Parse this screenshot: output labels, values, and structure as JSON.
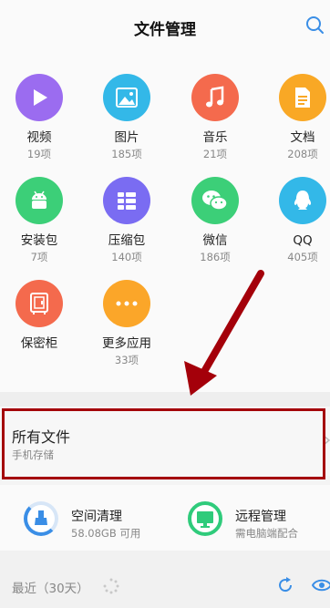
{
  "header": {
    "title": "文件管理"
  },
  "categories": [
    {
      "label": "视频",
      "count": "19项",
      "color": "#9b6cf0",
      "icon": "play-icon"
    },
    {
      "label": "图片",
      "count": "185项",
      "color": "#33b8e8",
      "icon": "image-icon"
    },
    {
      "label": "音乐",
      "count": "21项",
      "color": "#f46a4d",
      "icon": "music-note-icon"
    },
    {
      "label": "文档",
      "count": "208项",
      "color": "#f9a825",
      "icon": "document-icon"
    },
    {
      "label": "安装包",
      "count": "7项",
      "color": "#3ccf78",
      "icon": "android-icon"
    },
    {
      "label": "压缩包",
      "count": "140项",
      "color": "#7a6cf2",
      "icon": "archive-icon"
    },
    {
      "label": "微信",
      "count": "186项",
      "color": "#3ccf78",
      "icon": "wechat-icon"
    },
    {
      "label": "QQ",
      "count": "405项",
      "color": "#33b8e8",
      "icon": "qq-icon"
    },
    {
      "label": "保密柜",
      "count": "",
      "color": "#f46a4d",
      "icon": "safe-icon"
    },
    {
      "label": "更多应用",
      "count": "33项",
      "color": "#fba629",
      "icon": "more-icon"
    }
  ],
  "all_files": {
    "title": "所有文件",
    "subtitle": "手机存储"
  },
  "tools": [
    {
      "title": "空间清理",
      "subtitle": "58.08GB 可用",
      "color": "#3a8ee6",
      "icon": "broom-icon"
    },
    {
      "title": "远程管理",
      "subtitle": "需电脑端配合",
      "color": "#2fcb7b",
      "icon": "monitor-icon"
    }
  ],
  "recent": {
    "label": "最近（30天）"
  },
  "annotation_color": "#a4000a"
}
